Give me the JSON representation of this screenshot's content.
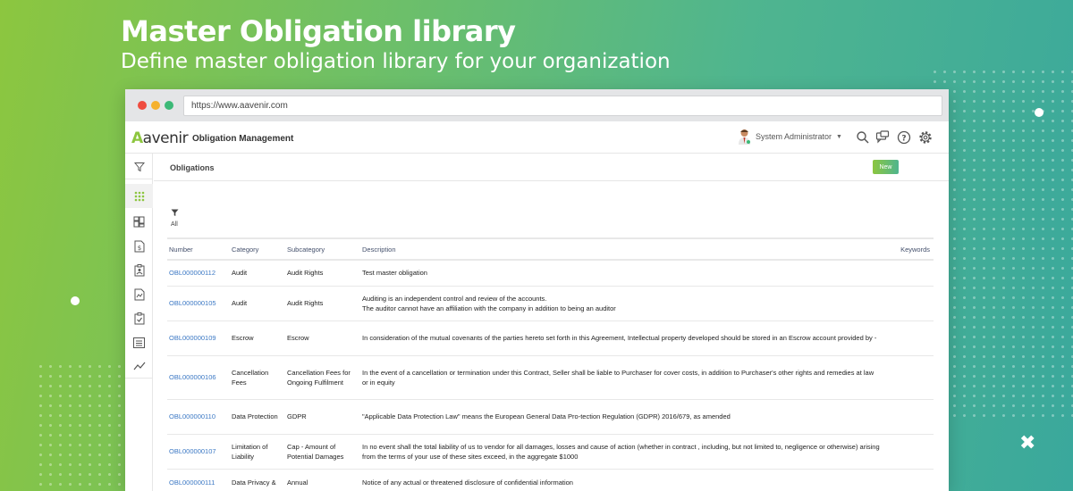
{
  "hero": {
    "title": "Master Obligation library",
    "subtitle": "Define master obligation library for your organization"
  },
  "browser": {
    "url": "https://www.aavenir.com",
    "traffic_colors": [
      "#ef4c3f",
      "#f5b12d",
      "#3cb977"
    ]
  },
  "app": {
    "logo": "aavenir",
    "module_title": "Obligation Management",
    "user_name": "System Administrator",
    "header_icons": [
      "search-icon",
      "chat-icon",
      "help-icon",
      "settings-icon"
    ],
    "sidebar_icons": [
      "filter-icon",
      "apps-grid-icon",
      "dashboard-icon",
      "dollar-doc-icon",
      "clipboard-user-icon",
      "signed-doc-icon",
      "clipboard-check-icon",
      "list-icon",
      "trend-chart-icon"
    ]
  },
  "list": {
    "title": "Obligations",
    "new_label": "New",
    "filter_label": "All",
    "columns": {
      "number": "Number",
      "category": "Category",
      "subcategory": "Subcategory",
      "description": "Description",
      "keywords": "Keywords"
    },
    "rows": [
      {
        "number": "OBL000000112",
        "category": "Audit",
        "subcategory": "Audit Rights",
        "description": "Test master obligation"
      },
      {
        "number": "OBL000000105",
        "category": "Audit",
        "subcategory": "Audit Rights",
        "description": "Auditing is an independent control and review of the accounts.\nThe auditor cannot have an affiliation with the company in addition to being an auditor"
      },
      {
        "number": "OBL000000109",
        "category": "Escrow",
        "subcategory": "Escrow",
        "description": "In consideration of the mutual covenants of the parties hereto set forth in this Agreement, Intellectual property developed should be stored in an Escrow account provided by -"
      },
      {
        "number": "OBL000000106",
        "category": "Cancellation Fees",
        "subcategory": "Cancellation Fees for Ongoing Fulfilment",
        "description": "In the event of a cancellation or termination under this Contract, Seller shall be liable to Purchaser for cover costs, in addition to Purchaser's other rights and remedies at law or in equity"
      },
      {
        "number": "OBL000000110",
        "category": "Data Protection",
        "subcategory": "GDPR",
        "description": "\"Applicable Data Protection Law\" means the European General Data Pro-tection  Regulation  (GDPR)  2016/679, as amended"
      },
      {
        "number": "OBL000000107",
        "category": "Limitation of Liability",
        "subcategory": "Cap - Amount of Potential Damages",
        "description": "In no event shall the total liability of us to vendor for all damages, losses and cause of action (whether in contract , including, but not limited to, negligence or otherwise) arising from the terms of your use of these sites exceed, in the aggregate $1000"
      },
      {
        "number": "OBL000000111",
        "category": "Data Privacy &",
        "subcategory": "Annual",
        "description": "Notice of any actual or threatened disclosure of confidential information"
      }
    ]
  }
}
